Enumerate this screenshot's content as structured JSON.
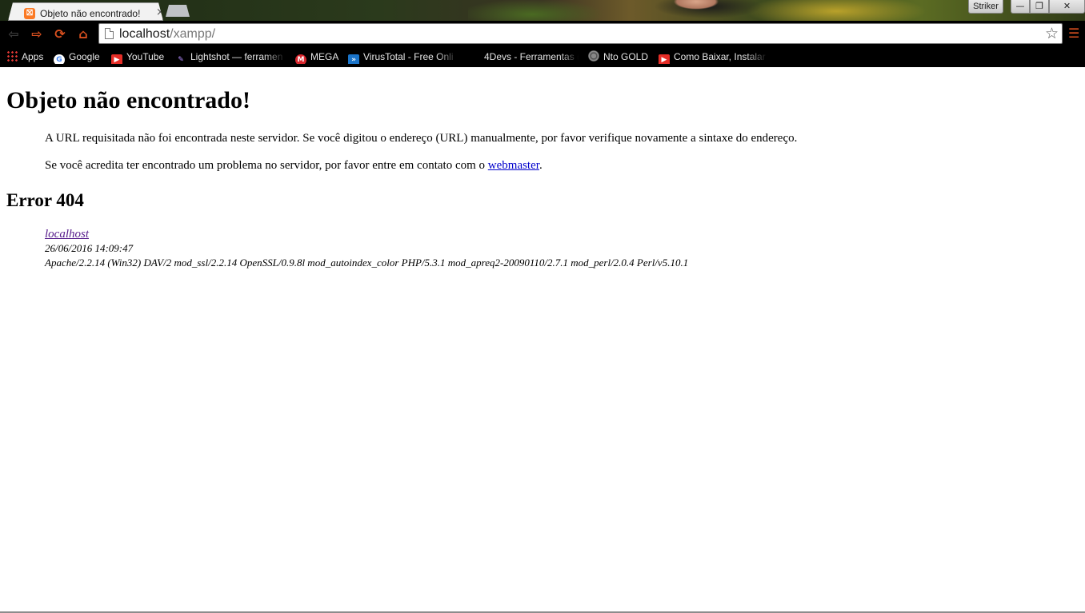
{
  "browser": {
    "tab": {
      "title": "Objeto não encontrado!",
      "close": "×",
      "favicon": "⛝"
    },
    "user": "Striker",
    "window_controls": {
      "minimize": "—",
      "maximize": "❐",
      "close": "✕"
    },
    "nav": {
      "back": "⇦",
      "forward": "⇨",
      "reload": "⟳",
      "home": "⌂",
      "menu": "☰",
      "star": "☆"
    },
    "address": {
      "host": "localhost",
      "path": "/xampp/"
    },
    "bookmarks": [
      {
        "label": "Apps",
        "icon": "apps-icon"
      },
      {
        "label": "Google",
        "icon": "google-icon"
      },
      {
        "label": "YouTube",
        "icon": "youtube-icon"
      },
      {
        "label": "Lightshot — ferramen",
        "icon": "lightshot-icon"
      },
      {
        "label": "MEGA",
        "icon": "mega-icon"
      },
      {
        "label": "VirusTotal - Free Onli",
        "icon": "virustotal-icon"
      },
      {
        "label": "4Devs - Ferramentas (",
        "icon": ""
      },
      {
        "label": "Nto GOLD",
        "icon": "nto-gold-icon"
      },
      {
        "label": "Como Baixar, Instalar",
        "icon": "youtube-icon"
      }
    ]
  },
  "page": {
    "heading": "Objeto não encontrado!",
    "message1": "A URL requisitada não foi encontrada neste servidor. Se você digitou o endereço (URL) manualmente, por favor verifique novamente a sintaxe do endereço.",
    "message2_prefix": "Se você acredita ter encontrado um problema no servidor, por favor entre em contato com o ",
    "message2_link": "webmaster",
    "message2_suffix": ".",
    "error_heading": "Error 404",
    "address_link": "localhost",
    "timestamp": "26/06/2016 14:09:47",
    "server_signature": "Apache/2.2.14 (Win32) DAV/2 mod_ssl/2.2.14 OpenSSL/0.9.8l mod_autoindex_color PHP/5.3.1 mod_apreq2-20090110/2.7.1 mod_perl/2.0.4 Perl/v5.10.1"
  }
}
